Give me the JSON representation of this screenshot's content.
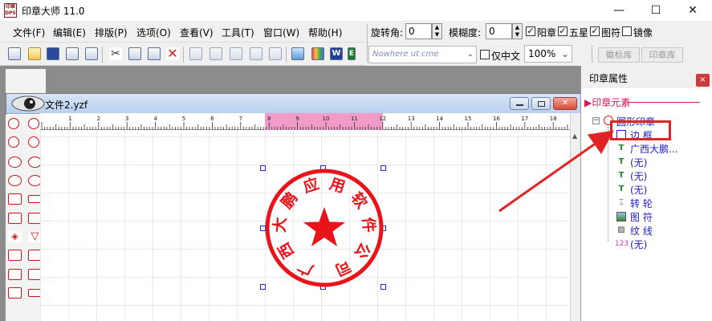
{
  "app": {
    "title": "印章大师 11.0",
    "icon_text": "印章\nDPS"
  },
  "window_controls": {
    "minimize": "—",
    "maximize": "☐",
    "close": "✕"
  },
  "menu": {
    "items": [
      "文件(F)",
      "编辑(E)",
      "排版(P)",
      "选项(O)",
      "查看(V)",
      "工具(T)",
      "窗口(W)",
      "帮助(H)"
    ]
  },
  "toolbar": {
    "icons": [
      "new-icon",
      "open-icon",
      "save-icon",
      "preview-icon",
      "print-icon",
      "cut-icon",
      "copy-icon",
      "paste-icon",
      "delete-icon",
      "align-left-icon",
      "align-center-icon",
      "align-right-icon",
      "align-top-icon",
      "align-bottom-icon",
      "image-icon",
      "color-icon",
      "word-icon",
      "excel-icon"
    ]
  },
  "stamp_toolbar": {
    "rotate_label": "旋转角:",
    "rotate_value": "0",
    "blur_label": "模糊度:",
    "blur_value": "0",
    "checks": [
      {
        "label": "阳章",
        "checked": true
      },
      {
        "label": "五星",
        "checked": true
      },
      {
        "label": "图符",
        "checked": true
      },
      {
        "label": "镜像",
        "checked": false
      }
    ],
    "font_dropdown_value": "Nowhere   ut   cme",
    "only_chinese_label": "仅中文",
    "zoom_value": "100%",
    "tabs": [
      "徽标库",
      "印章库"
    ]
  },
  "document": {
    "title": "文件2.yzf",
    "ruler_ticks": [
      "1",
      "2",
      "3",
      "4",
      "5",
      "6",
      "7",
      "8",
      "9",
      "10",
      "11",
      "12",
      "13",
      "14",
      "15",
      "16",
      "17",
      "18"
    ]
  },
  "stamp": {
    "text": "广西大鹏应用软件公司",
    "color": "#e8141a"
  },
  "props_panel": {
    "title": "印章属性",
    "close": "×",
    "section": "▶印章元素",
    "tree": [
      {
        "label": "圆形印章",
        "icon": "stamp-root-icon",
        "level": 0
      },
      {
        "label": "边 框",
        "icon": "border-icon",
        "level": 1
      },
      {
        "label": "广西大鹏...",
        "icon": "text-icon",
        "level": 1
      },
      {
        "label": "(无)",
        "icon": "text-icon",
        "level": 1
      },
      {
        "label": "(无)",
        "icon": "text-icon",
        "level": 1
      },
      {
        "label": "(无)",
        "icon": "text-icon",
        "level": 1
      },
      {
        "label": "转 轮",
        "icon": "wheel-icon",
        "level": 1
      },
      {
        "label": "图 符",
        "icon": "image-icon",
        "level": 1
      },
      {
        "label": "纹 线",
        "icon": "hatch-icon",
        "level": 1
      },
      {
        "label": "(无)",
        "icon": "number-icon",
        "level": 1
      }
    ]
  },
  "colors": {
    "accent_red": "#e8141a",
    "highlight": "#d4145a",
    "tree_blue": "#1d1dc9",
    "annotation_box": "#e02424"
  }
}
